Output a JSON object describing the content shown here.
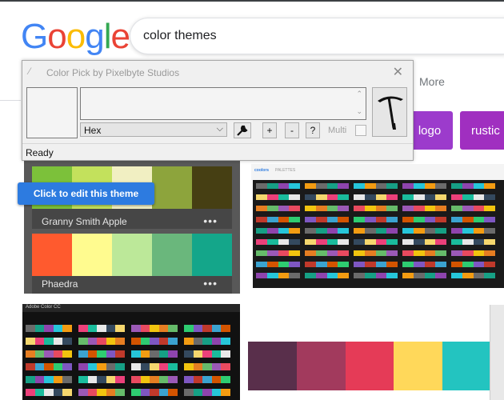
{
  "google": {
    "logo_letters": [
      {
        "ch": "G",
        "color": "#4285f4"
      },
      {
        "ch": "o",
        "color": "#ea4335"
      },
      {
        "ch": "o",
        "color": "#fbbc05"
      },
      {
        "ch": "g",
        "color": "#4285f4"
      },
      {
        "ch": "l",
        "color": "#34a853"
      },
      {
        "ch": "e",
        "color": "#ea4335"
      }
    ],
    "search_value": "color themes",
    "more_label": "More",
    "chips": [
      "logo",
      "rustic"
    ]
  },
  "results": {
    "adobe_themes": [
      {
        "name": "Granny Smith Apple",
        "colors": [
          "#7cc13a",
          "#c3e15c",
          "#f1efc2",
          "#8da43c",
          "#463f13"
        ]
      },
      {
        "name": "Phaedra",
        "colors": [
          "#ff5a2e",
          "#fffb8f",
          "#bce899",
          "#6ab77c",
          "#14a68a"
        ]
      }
    ],
    "edit_button": "Click to edit this theme",
    "more_dots": "•••",
    "coolors_brand": "coolors",
    "coolors_subtitle": "PALETTES",
    "adobe_cc_title": "Adobe Color CC",
    "big_palette": [
      "#592f4b",
      "#a23a5d",
      "#e53b57",
      "#ffd85a",
      "#23c4c0"
    ]
  },
  "color_pick": {
    "title": "Color Pick by Pixelbyte Studios",
    "format_value": "Hex",
    "btn_plus": "+",
    "btn_minus": "-",
    "btn_help": "?",
    "multi_label": "Multi",
    "status": "Ready"
  }
}
